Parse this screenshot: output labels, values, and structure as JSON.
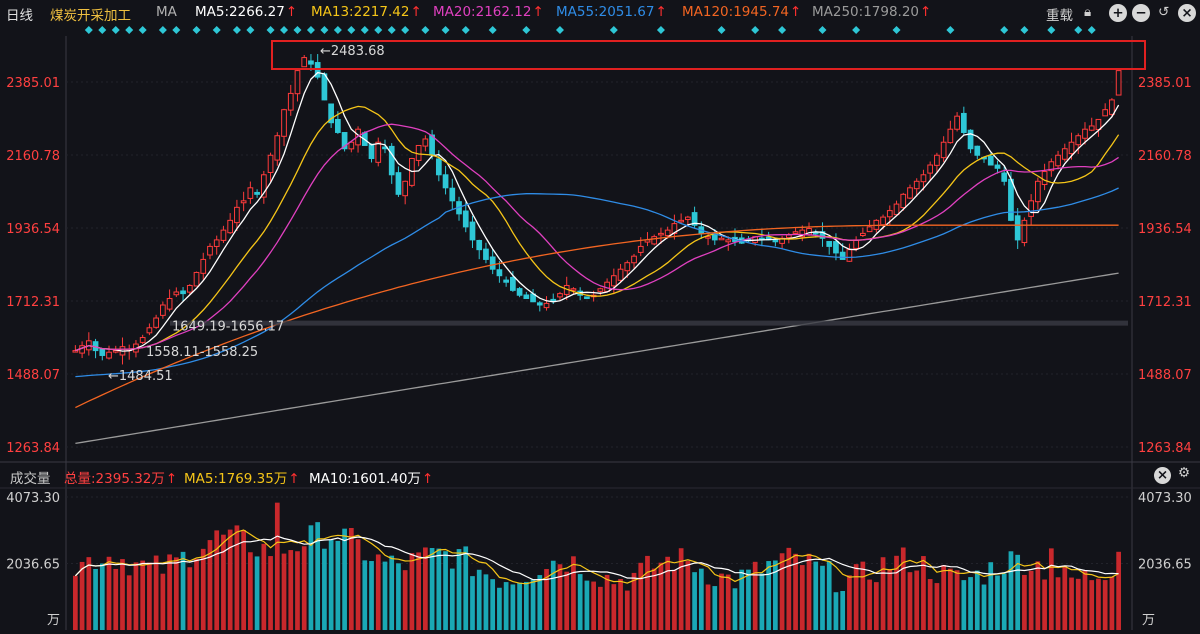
{
  "header": {
    "period": "日线",
    "name": "煤炭开采加工",
    "indicator": "MA",
    "ma5": "MA5:2266.27",
    "ma13": "MA13:2217.42",
    "ma20": "MA20:2162.12",
    "ma55": "MA55:2051.67",
    "ma120": "MA120:1945.74",
    "ma250": "MA250:1798.20",
    "reload": "重载"
  },
  "volume_header": {
    "title": "成交量",
    "total": "总量:2395.32万",
    "ma5": "MA5:1769.35万",
    "ma10": "MA10:1601.40万"
  },
  "colors": {
    "up": "#ff3b3b",
    "down": "#2ec7d6",
    "ma5": "#ffffff",
    "ma13": "#f5c518",
    "ma20": "#e040c0",
    "ma55": "#2f8ce6",
    "ma120": "#f26522",
    "ma250": "#9a9a9a",
    "highlight_box": "#e02020",
    "marker": "#2ec7d6"
  },
  "icons": [
    "lock-icon",
    "plus-circle-icon",
    "minus-circle-icon",
    "undo-icon",
    "close-circle-icon",
    "settings-icon"
  ],
  "chart_data": [
    {
      "type": "candlestick",
      "title": "煤炭开采加工",
      "y_ticks": [
        2385.01,
        2160.78,
        1936.54,
        1712.31,
        1488.07,
        1263.84
      ],
      "ylim": [
        1263.84,
        2385.01
      ],
      "annotations": [
        "←2483.68",
        "1649.19-1656.17",
        "1558.11-1558.25",
        "←1484.51"
      ],
      "highlight": "red rectangle around the 2483.68 high",
      "series": [
        {
          "name": "MA5",
          "last": 2266.27
        },
        {
          "name": "MA13",
          "last": 2217.42
        },
        {
          "name": "MA20",
          "last": 2162.12
        },
        {
          "name": "MA55",
          "last": 2051.67
        },
        {
          "name": "MA120",
          "last": 1945.74
        },
        {
          "name": "MA250",
          "last": 1798.2
        }
      ],
      "close_path": [
        1560,
        1575,
        1590,
        1560,
        1545,
        1555,
        1560,
        1572,
        1565,
        1580,
        1600,
        1630,
        1660,
        1700,
        1720,
        1740,
        1735,
        1760,
        1800,
        1840,
        1880,
        1900,
        1930,
        1960,
        2000,
        2020,
        2060,
        2040,
        2100,
        2160,
        2220,
        2300,
        2350,
        2420,
        2460,
        2440,
        2400,
        2330,
        2260,
        2230,
        2180,
        2200,
        2240,
        2190,
        2150,
        2200,
        2180,
        2100,
        2040,
        2080,
        2150,
        2190,
        2210,
        2160,
        2100,
        2060,
        2020,
        1980,
        1940,
        1900,
        1870,
        1840,
        1810,
        1790,
        1770,
        1745,
        1730,
        1720,
        1710,
        1700,
        1705,
        1715,
        1735,
        1760,
        1750,
        1730,
        1720,
        1730,
        1750,
        1770,
        1790,
        1810,
        1830,
        1850,
        1880,
        1900,
        1910,
        1920,
        1930,
        1950,
        1960,
        1970,
        1945,
        1920,
        1910,
        1900,
        1905,
        1900,
        1895,
        1890,
        1900,
        1910,
        1905,
        1900,
        1895,
        1905,
        1915,
        1925,
        1930,
        1935,
        1920,
        1905,
        1880,
        1860,
        1840,
        1870,
        1900,
        1920,
        1940,
        1960,
        1970,
        1990,
        2010,
        2040,
        2060,
        2080,
        2100,
        2130,
        2160,
        2200,
        2240,
        2280,
        2230,
        2180,
        2160,
        2150,
        2130,
        2120,
        2080,
        1960,
        1900,
        1960,
        2020,
        2080,
        2110,
        2140,
        2160,
        2180,
        2200,
        2220,
        2240,
        2250,
        2270,
        2300,
        2330,
        2420
      ]
    },
    {
      "type": "bar",
      "title": "成交量",
      "unit": "万",
      "y_ticks": [
        4073.3,
        2036.65
      ],
      "ylim": [
        0,
        4073.3
      ],
      "series": [
        {
          "name": "MA5",
          "last": 1769.35
        },
        {
          "name": "MA10",
          "last": 1601.4
        }
      ]
    }
  ]
}
